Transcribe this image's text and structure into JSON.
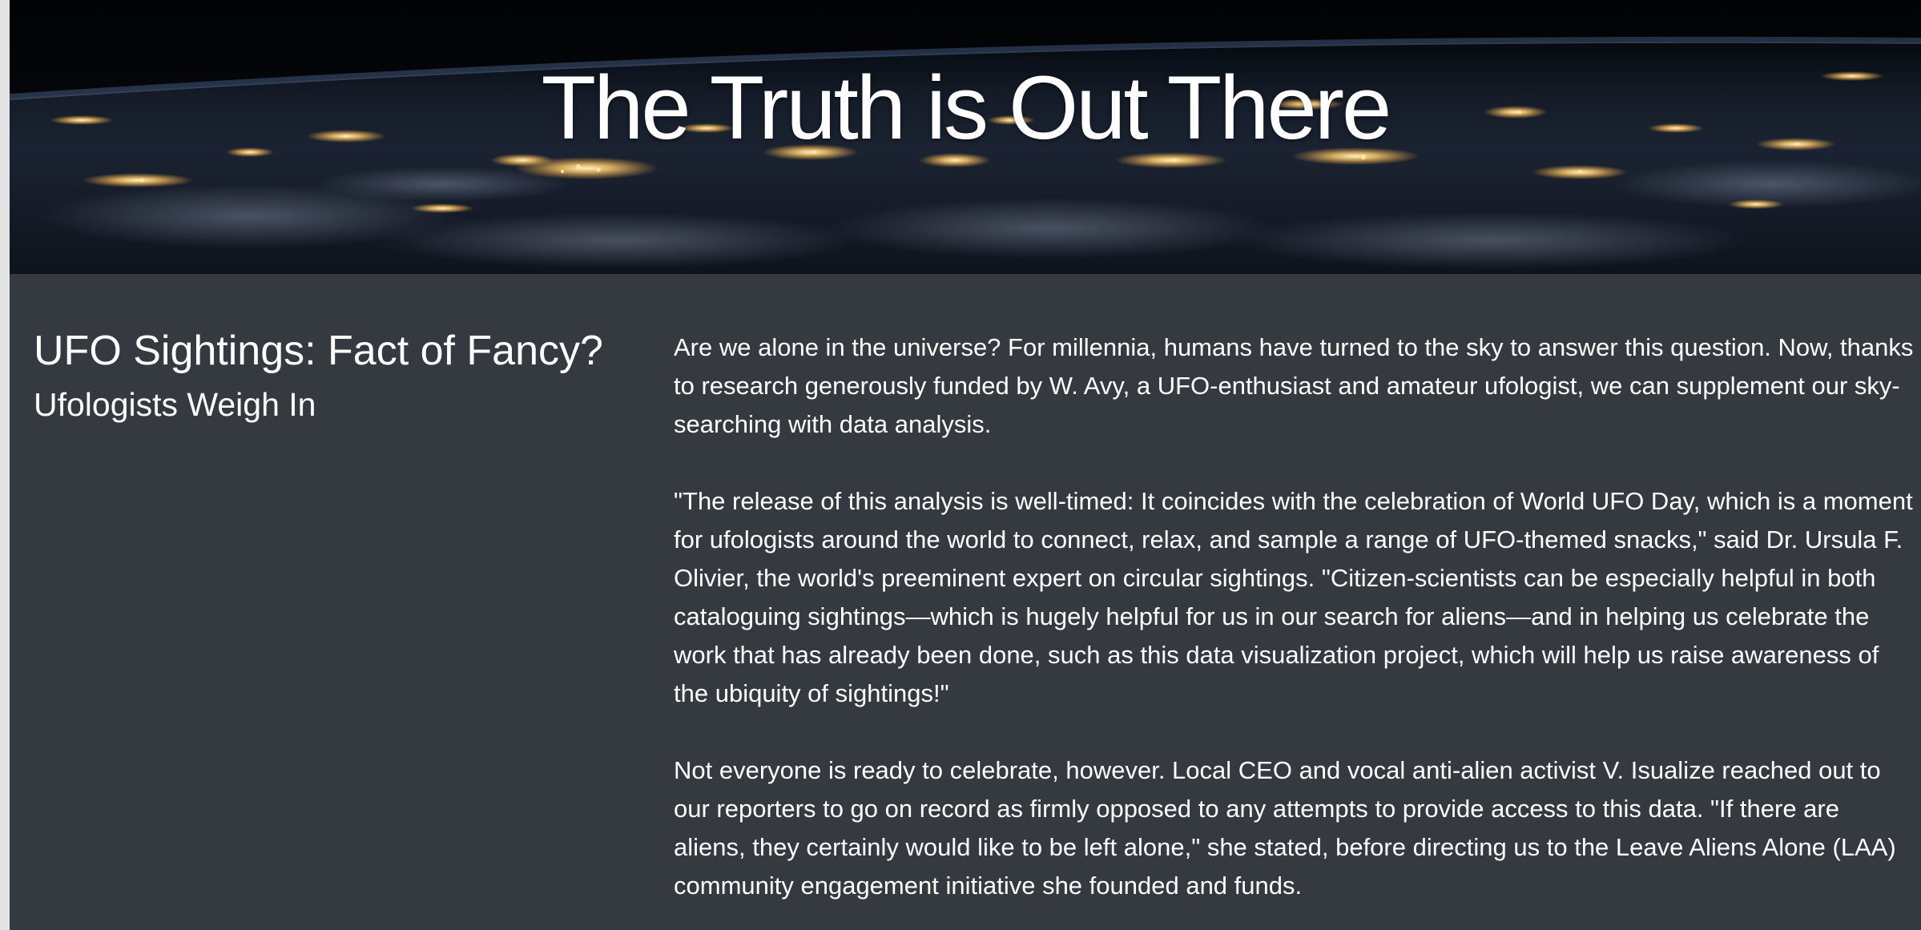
{
  "hero": {
    "title": "The Truth is Out There"
  },
  "headline": {
    "title": "UFO Sightings: Fact of Fancy?",
    "subtitle": "Ufologists Weigh In"
  },
  "article": {
    "paragraphs": [
      "Are we alone in the universe? For millennia, humans have turned to the sky to answer this question. Now, thanks to research generously funded by W. Avy, a UFO-enthusiast and amateur ufologist, we can supplement our sky-searching with data analysis.",
      "\"The release of this analysis is well-timed: It coincides with the celebration of World UFO Day, which is a moment for ufologists around the world to connect, relax, and sample a range of UFO-themed snacks,\" said Dr. Ursula F. Olivier, the world's preeminent expert on circular sightings. \"Citizen-scientists can be especially helpful in both cataloguing sightings—which is hugely helpful for us in our search for aliens—and in helping us celebrate the work that has already been done, such as this data visualization project, which will help us raise awareness of the ubiquity of sightings!\"",
      "Not everyone is ready to celebrate, however. Local CEO and vocal anti-alien activist V. Isualize reached out to our reporters to go on record as firmly opposed to any attempts to provide access to this data. \"If there are aliens, they certainly would like to be left alone,\" she stated, before directing us to the Leave Aliens Alone (LAA) community engagement initiative she founded and funds."
    ]
  },
  "colors": {
    "page_background": "#343a40",
    "text": "#ffffff",
    "city_lights": "#f5c46a"
  }
}
